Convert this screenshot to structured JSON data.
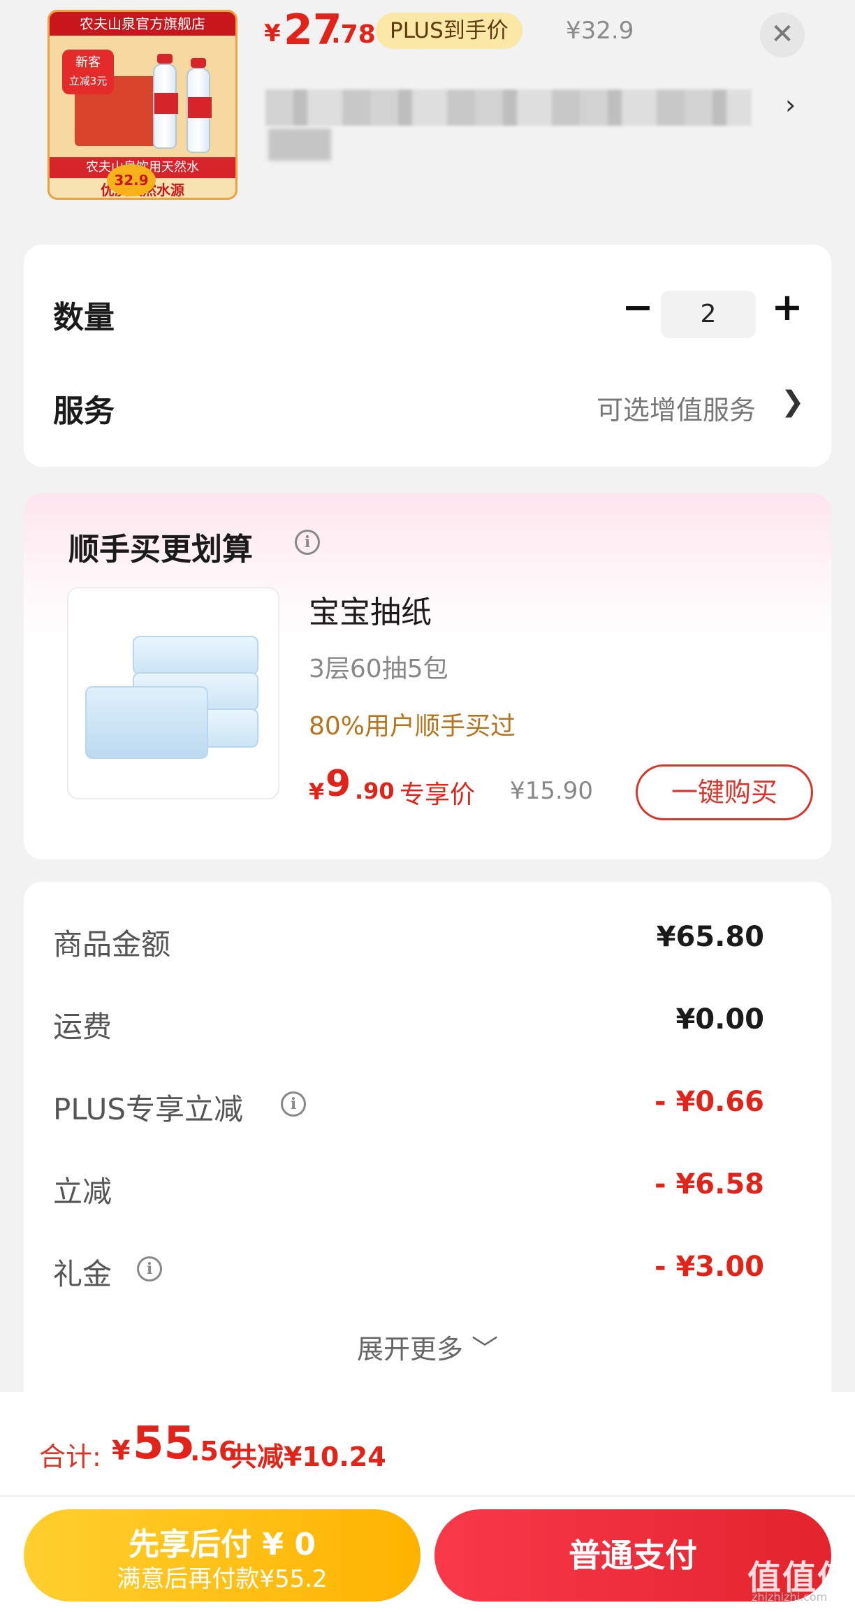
{
  "product": {
    "thumb": {
      "store_banner": "农夫山泉官方旗舰店",
      "badge_line1": "新客",
      "badge_line2": "立减3元",
      "strip_text": "农夫山泉饮用天然水",
      "bottom_text": "优质天然水源",
      "circle_price": "32.9"
    },
    "price": {
      "symbol": "¥",
      "integer": "27",
      "decimal": ".78"
    },
    "plus_badge": "PLUS到手价",
    "original_price": "¥32.9",
    "close_icon": "close-icon"
  },
  "quantity": {
    "label": "数量",
    "value": "2",
    "minus": "−",
    "plus": "+"
  },
  "service": {
    "label": "服务",
    "value": "可选增值服务",
    "chevron": "❯"
  },
  "bundle": {
    "title": "顺手买更划算",
    "info_icon": "i",
    "item": {
      "name": "宝宝抽纸",
      "spec": "3层60抽5包",
      "hint": "80%用户顺手买过",
      "price_symbol": "¥",
      "price_int": "9",
      "price_dec": ".90",
      "price_tag": "专享价",
      "original_price": "¥15.90",
      "buy_button": "一键购买"
    }
  },
  "summary": {
    "rows": [
      {
        "label": "商品金额",
        "value": "¥65.80",
        "red": false,
        "info": false
      },
      {
        "label": "运费",
        "value": "¥0.00",
        "red": false,
        "info": false
      },
      {
        "label": "PLUS专享立减",
        "value": "- ¥0.66",
        "red": true,
        "info": true
      },
      {
        "label": "立减",
        "value": "- ¥6.58",
        "red": true,
        "info": false
      },
      {
        "label": "礼金",
        "value": "- ¥3.00",
        "red": true,
        "info": true
      }
    ],
    "expand_more": "展开更多 ﹀"
  },
  "bottom": {
    "total_label": "合计:",
    "total_symbol": "¥",
    "total_int": "55",
    "total_dec": ".56",
    "total_saved": "共减¥10.24",
    "pay_later_title": "先享后付 ¥ 0",
    "pay_later_sub": "满意后再付款¥55.2",
    "pay_normal": "普通支付",
    "watermark": "值值值",
    "watermark_sub": "zhizhizhi.com"
  },
  "colors": {
    "accent_red": "#e2231a",
    "plus_gold": "#fbe7a6",
    "pay_later_yellow": "#ffb300",
    "hint_orange": "#b8741a"
  }
}
